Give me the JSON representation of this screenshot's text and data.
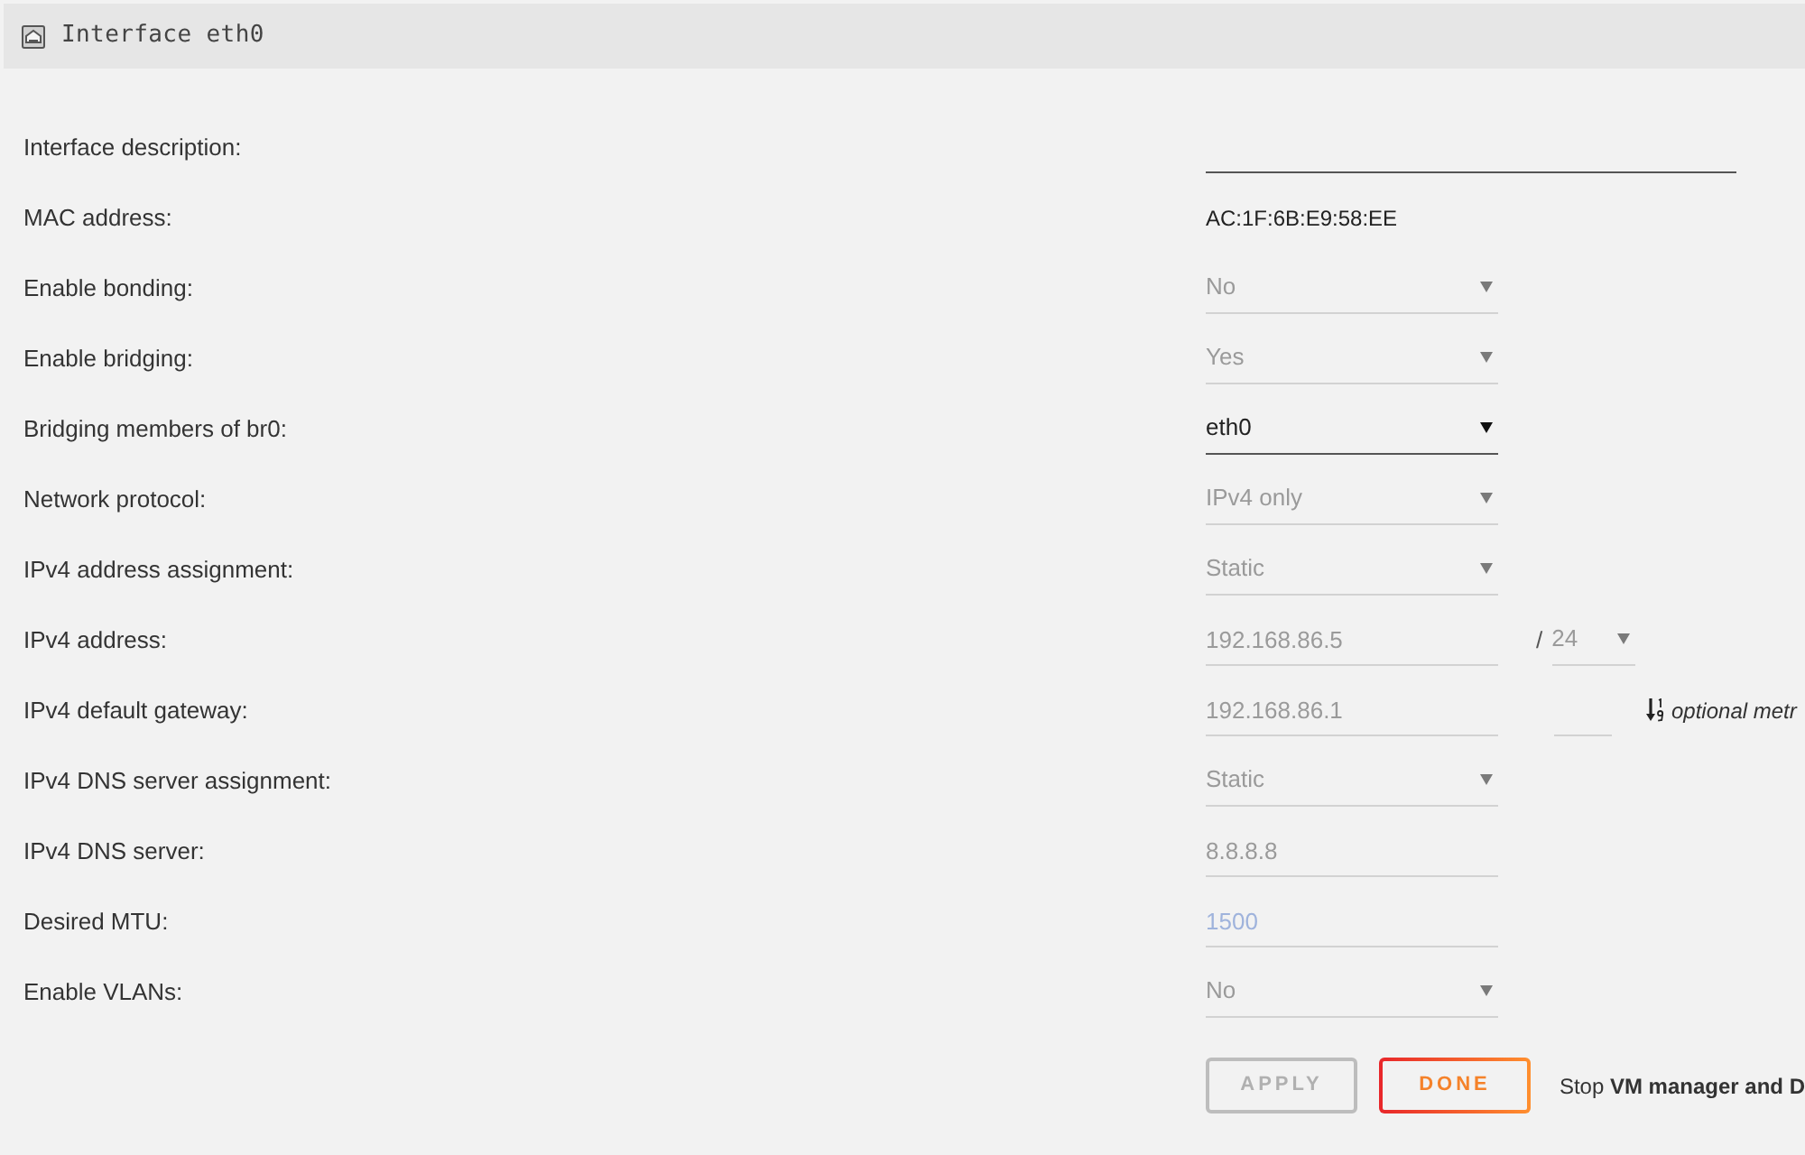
{
  "header": {
    "title": "Interface eth0"
  },
  "rows": [
    {
      "label": "Interface description:",
      "kind": "long_input",
      "disabled": false
    },
    {
      "label": "MAC address:",
      "kind": "static",
      "value": "AC:1F:6B:E9:58:EE"
    },
    {
      "label": "Enable bonding:",
      "kind": "select",
      "value": "No",
      "disabled": true
    },
    {
      "label": "Enable bridging:",
      "kind": "select",
      "value": "Yes",
      "disabled": true
    },
    {
      "label": "Bridging members of br0:",
      "kind": "select",
      "value": "eth0",
      "disabled": false
    },
    {
      "label": "Network protocol:",
      "kind": "select",
      "value": "IPv4 only",
      "disabled": true
    },
    {
      "label": "IPv4 address assignment:",
      "kind": "select",
      "value": "Static",
      "disabled": true
    },
    {
      "label": "IPv4 address:",
      "kind": "input",
      "value": "192.168.86.5",
      "disabled": true,
      "suffix": {
        "separator": "/",
        "value": "24",
        "disabled": true
      }
    },
    {
      "label": "IPv4 default gateway:",
      "kind": "input",
      "value": "192.168.86.1",
      "disabled": true,
      "metric": {
        "note": "optional metr",
        "disabled": true
      }
    },
    {
      "label": "IPv4 DNS server assignment:",
      "kind": "select",
      "value": "Static",
      "disabled": true
    },
    {
      "label": "IPv4 DNS server:",
      "kind": "input",
      "value": "8.8.8.8",
      "disabled": true
    },
    {
      "label": "Desired MTU:",
      "kind": "input",
      "placeholder": "1500",
      "disabled": true
    },
    {
      "label": "Enable VLANs:",
      "kind": "select",
      "value": "No",
      "disabled": true
    }
  ],
  "buttons": [
    {
      "label": "APPLY",
      "disabled": true
    },
    {
      "label": "DONE",
      "disabled": false
    }
  ],
  "note": "Stop **VM manager and D**"
}
